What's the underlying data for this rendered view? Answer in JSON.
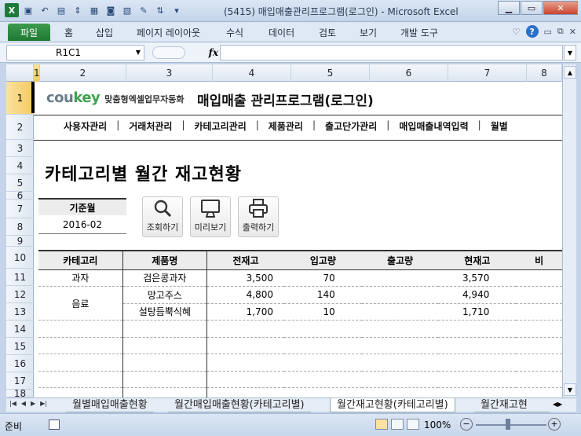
{
  "window": {
    "title": "(5415) 매입매출관리프로그램(로그인)  -  Microsoft Excel",
    "qat_icons": [
      "excel-icon",
      "save-icon",
      "undo-icon",
      "form-icon",
      "spin-icon",
      "table-icon",
      "camera-icon",
      "image-icon",
      "edit-icon",
      "sort-icon",
      "customize-icon"
    ]
  },
  "ribbon": {
    "tabs": [
      "파일",
      "홈",
      "삽입",
      "페이지 레이아웃",
      "수식",
      "데이터",
      "검토",
      "보기",
      "개발 도구"
    ]
  },
  "formula_bar": {
    "name_box": "R1C1",
    "fx": "fx",
    "formula": ""
  },
  "columns": [
    "1",
    "2",
    "3",
    "4",
    "5",
    "6",
    "7",
    "8"
  ],
  "rows": [
    "1",
    "2",
    "3",
    "4",
    "5",
    "6",
    "7",
    "8",
    "9",
    "10",
    "11",
    "12",
    "13",
    "14",
    "15",
    "16",
    "17",
    "18"
  ],
  "brand": {
    "logo_a": "cou",
    "logo_b": "key",
    "tagline": "맞춤형엑셀업무자동화",
    "app_title": "매입매출 관리프로그램(로그인)"
  },
  "menu": [
    "사용자관리",
    "거래처관리",
    "카테고리관리",
    "제품관리",
    "출고단가관리",
    "매입매출내역입력",
    "월별"
  ],
  "page_title": "카테고리별 월간 재고현황",
  "base_month": {
    "label": "기준월",
    "value": "2016-02"
  },
  "buttons": {
    "search": "조회하기",
    "preview": "미리보기",
    "print": "출력하기"
  },
  "table": {
    "headers": [
      "카테고리",
      "제품명",
      "전재고",
      "입고량",
      "출고량",
      "현재고",
      "비"
    ],
    "rows": [
      {
        "category": "과자",
        "product": "검은콩과자",
        "prev": "3,500",
        "in": "70",
        "out": "",
        "current": "3,570"
      },
      {
        "category": "음료",
        "product": "망고주스",
        "prev": "4,800",
        "in": "140",
        "out": "",
        "current": "4,940"
      },
      {
        "category": "",
        "product": "설탕듬뿍식혜",
        "prev": "1,700",
        "in": "10",
        "out": "",
        "current": "1,710"
      }
    ]
  },
  "sheet_tabs": [
    "월별매입매출현황",
    "월간매입매출현황(카테고리별)",
    "월간재고현황(카테고리별)",
    "월간재고현"
  ],
  "active_sheet": 2,
  "status": {
    "ready": "준비",
    "zoom": "100%",
    "zoom_minus": "−",
    "zoom_plus": "+"
  }
}
